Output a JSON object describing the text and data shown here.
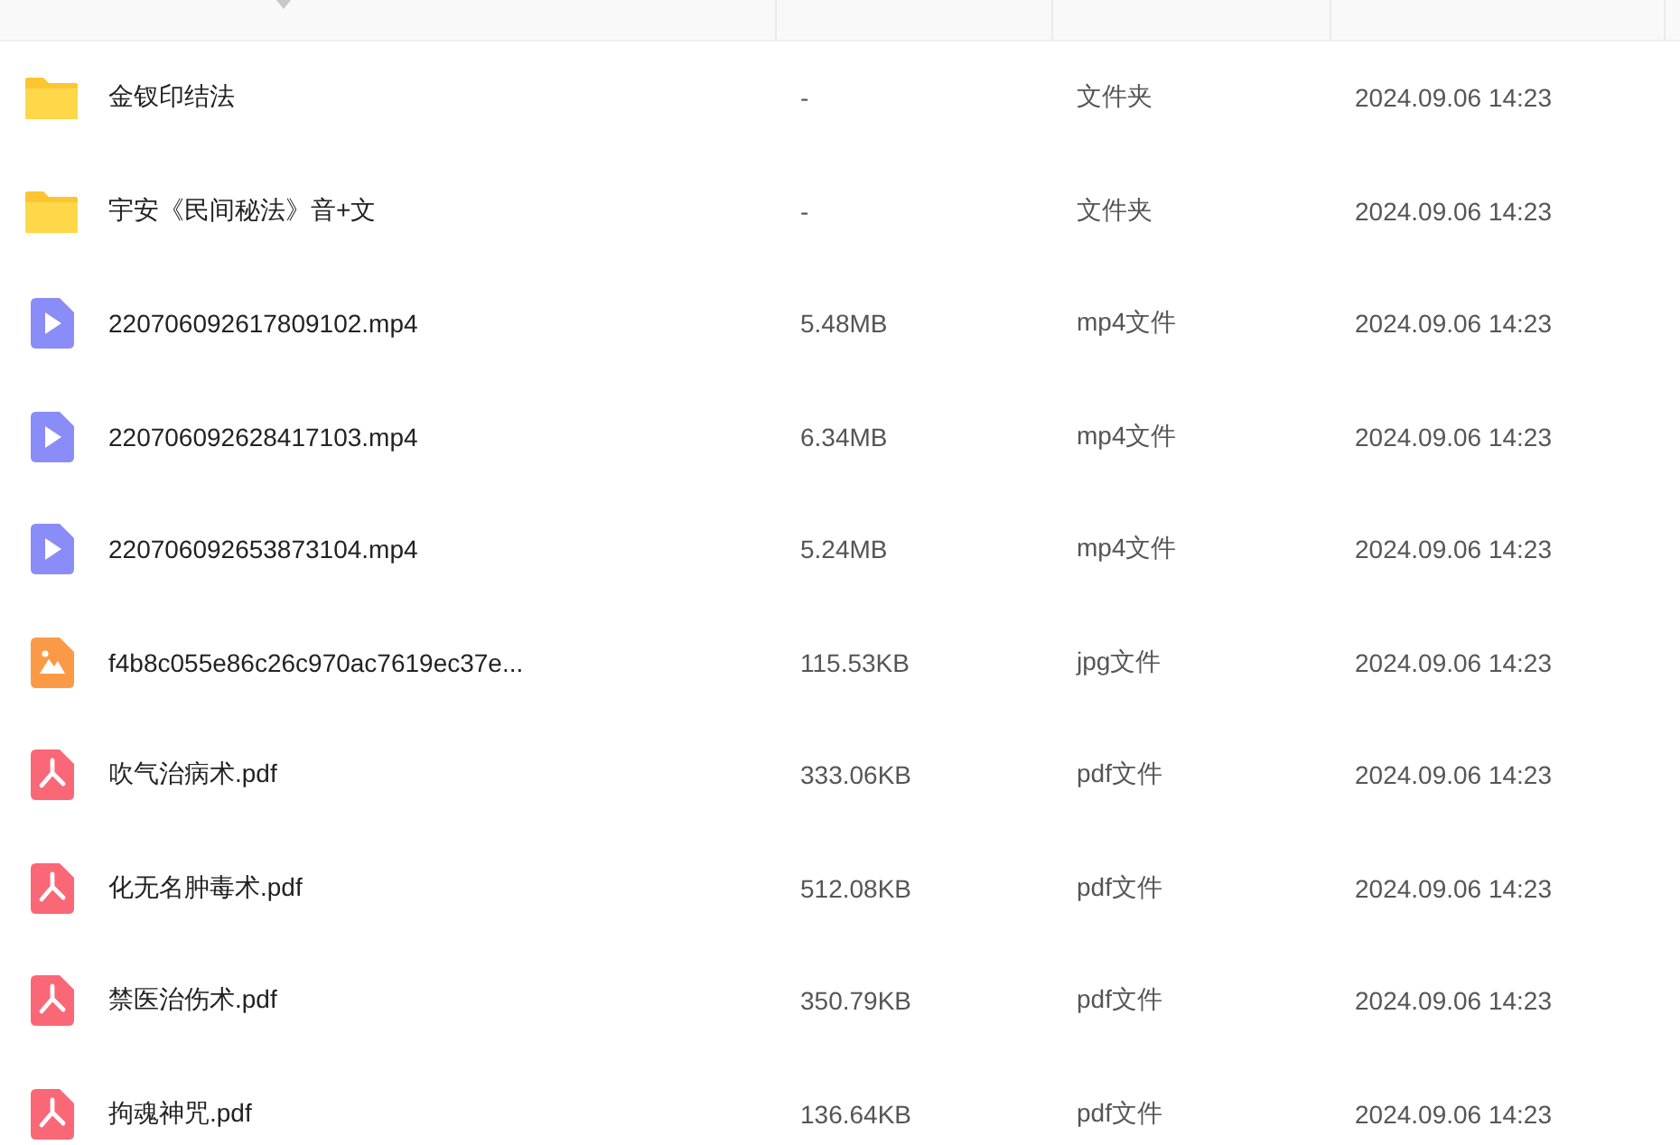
{
  "files": [
    {
      "kind": "folder",
      "name": "金钗印结法",
      "size": "-",
      "type": "文件夹",
      "modified": "2024.09.06 14:23"
    },
    {
      "kind": "folder",
      "name": "宇安《民间秘法》音+文",
      "size": "-",
      "type": "文件夹",
      "modified": "2024.09.06 14:23"
    },
    {
      "kind": "video",
      "name": "220706092617809102.mp4",
      "size": "5.48MB",
      "type": "mp4文件",
      "modified": "2024.09.06 14:23"
    },
    {
      "kind": "video",
      "name": "220706092628417103.mp4",
      "size": "6.34MB",
      "type": "mp4文件",
      "modified": "2024.09.06 14:23"
    },
    {
      "kind": "video",
      "name": "220706092653873104.mp4",
      "size": "5.24MB",
      "type": "mp4文件",
      "modified": "2024.09.06 14:23"
    },
    {
      "kind": "image",
      "name": "f4b8c055e86c26c970ac7619ec37e...",
      "size": "115.53KB",
      "type": "jpg文件",
      "modified": "2024.09.06 14:23"
    },
    {
      "kind": "pdf",
      "name": "吹气治病术.pdf",
      "size": "333.06KB",
      "type": "pdf文件",
      "modified": "2024.09.06 14:23"
    },
    {
      "kind": "pdf",
      "name": "化无名肿毒术.pdf",
      "size": "512.08KB",
      "type": "pdf文件",
      "modified": "2024.09.06 14:23"
    },
    {
      "kind": "pdf",
      "name": "禁医治伤术.pdf",
      "size": "350.79KB",
      "type": "pdf文件",
      "modified": "2024.09.06 14:23"
    },
    {
      "kind": "pdf",
      "name": "拘魂神咒.pdf",
      "size": "136.64KB",
      "type": "pdf文件",
      "modified": "2024.09.06 14:23"
    }
  ]
}
